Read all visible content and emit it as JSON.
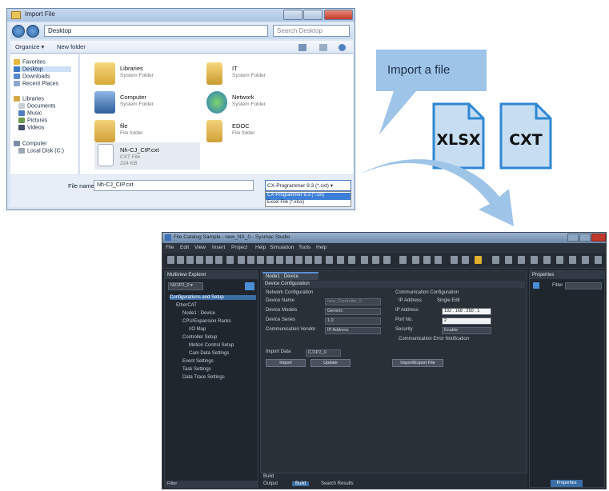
{
  "colors": {
    "callout": "#9ec4e8",
    "file_icon_fill": "#c6ddf2",
    "file_icon_stroke": "#2f87d2",
    "arrow": "#9ec4e8",
    "dialog_bg": "#dbe6f3",
    "app_bg": "#1d232b"
  },
  "callout": {
    "text": "Import a file"
  },
  "file_icons": [
    {
      "label": "XLSX"
    },
    {
      "label": "CXT"
    }
  ],
  "dialog": {
    "title": "Import File",
    "path": "Desktop",
    "search": "Search Desktop",
    "toolbar": {
      "organize": "Organize ▾",
      "new_folder": "New folder"
    },
    "nav": [
      {
        "label": "Favorites",
        "icon": "star-icon"
      },
      {
        "label": "Desktop",
        "icon": "desktop-icon",
        "selected": true
      },
      {
        "label": "Downloads",
        "icon": "downloads-icon"
      },
      {
        "label": "Recent Places",
        "icon": "recent-icon"
      },
      {
        "label": "Libraries",
        "icon": "libraries-icon"
      },
      {
        "label": "Documents",
        "icon": "documents-icon"
      },
      {
        "label": "Music",
        "icon": "music-icon"
      },
      {
        "label": "Pictures",
        "icon": "pictures-icon"
      },
      {
        "label": "Videos",
        "icon": "videos-icon"
      },
      {
        "label": "Computer",
        "icon": "computer-icon"
      },
      {
        "label": "Local Disk (C:)",
        "icon": "disk-icon"
      }
    ],
    "files": [
      {
        "name": "Libraries",
        "sub": "System Folder",
        "icon": "library-folder-icon"
      },
      {
        "name": "Computer",
        "sub": "System Folder",
        "icon": "computer-icon"
      },
      {
        "name": "file",
        "sub": "File folder",
        "icon": "folder-icon"
      },
      {
        "name": "Nh-CJ_CIP.cxt",
        "sub": "CXT File",
        "sub2": "224 KB",
        "icon": "document-icon"
      },
      {
        "name": "IT",
        "sub": "System Folder",
        "icon": "user-folder-icon"
      },
      {
        "name": "Network",
        "sub": "System Folder",
        "icon": "network-icon"
      },
      {
        "name": "EDOC",
        "sub": "File folder",
        "icon": "folder-icon"
      }
    ],
    "filename_label": "File name:",
    "filename_value": "Nh-CJ_CIP.cxt",
    "filetype_value": "CX-Programmer 9.3 (*.cxt) ▾",
    "dropdown": [
      "CX-Programmer 9.3 (*.cxt)",
      "Excel File (*.xlsx)"
    ]
  },
  "app": {
    "title": "File Catalog Sample - new_NX_0 - Sysmac Studio",
    "menu": [
      "File",
      "Edit",
      "View",
      "Insert",
      "Project",
      "Help",
      "Simulation",
      "Tools",
      "Help"
    ],
    "explorer_title": "Multiview Explorer",
    "device_select": "NX1P2_0 ▾",
    "tree": [
      "Configurations and Setup",
      "EtherCAT",
      "Node1 : Device",
      "CPU/Expansion Racks",
      "I/O Map",
      "Controller Setup",
      "Motion Control Setup",
      "Cam Data Settings",
      "Event Settings",
      "Task Settings",
      "Data Trace Settings"
    ],
    "bottom_item": "Filter",
    "tab": "Node1 : Device",
    "section": "Device Configuration",
    "left_group": "Network Configuration",
    "fields": [
      {
        "label": "Device Name",
        "value": "new_Controller_0"
      },
      {
        "label": "Device Models",
        "value": "Generic"
      },
      {
        "label": "Device Series",
        "value": "1.0"
      },
      {
        "label": "Communication Vendor",
        "value": "IP Address"
      }
    ],
    "right_group": "Communication Configuration",
    "radio1": "IP Address",
    "radio2": "Single Edit",
    "ip_label": "IP Address",
    "ip_value": "192 . 168 . 250 . 1",
    "port_label": "Port No.",
    "port_value": "2",
    "security_label": "Security",
    "security_value": "Enable",
    "check_label": "Communication Error Notification",
    "import_label": "Import Data",
    "import_value": "CJ1P2_0",
    "btn_import": "Import",
    "btn_update": "Update",
    "btn_export": "Import/Export File",
    "props_title": "Properties",
    "props_filter": "Filter",
    "output_title": "Build",
    "output_tabs": [
      "Output",
      "Build",
      "Search Results"
    ],
    "props_tab": "Properties"
  }
}
